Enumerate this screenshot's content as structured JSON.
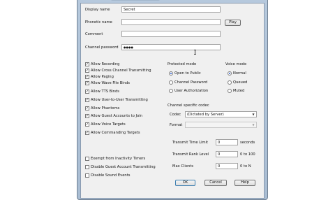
{
  "fields": {
    "display_name_label": "Display name",
    "display_name_value": "Secret",
    "phonetic_label": "Phonetic name",
    "phonetic_value": "",
    "play_label": "Play",
    "comment_label": "Comment",
    "comment_value": "",
    "password_label": "Channel password",
    "password_value": "●●●●"
  },
  "checkboxes": [
    {
      "label": "Allow Recording",
      "checked": true
    },
    {
      "label": "Allow Cross Channel Transmitting",
      "checked": true
    },
    {
      "label": "Allow Paging",
      "checked": true
    },
    {
      "label": "Allow Wave File Binds",
      "checked": true
    },
    {
      "label": "Allow TTS Binds",
      "checked": true
    },
    {
      "label": "Allow User-to-User Transmitting",
      "checked": true
    },
    {
      "label": "Allow Phantoms",
      "checked": true
    },
    {
      "label": "Allow Guest Accounts to Join",
      "checked": true
    },
    {
      "label": "Allow Voice Targets",
      "checked": true
    },
    {
      "label": "Allow Commanding Targets",
      "checked": true
    }
  ],
  "extra_checkboxes": [
    {
      "label": "Exempt from Inactivity Timers",
      "checked": false
    },
    {
      "label": "Disable Guest Account Transmitting",
      "checked": false
    },
    {
      "label": "Disable Sound Events",
      "checked": false
    }
  ],
  "protected_mode": {
    "title": "Protected mode",
    "options": [
      "Open to Public",
      "Channel Password",
      "User Authorization"
    ],
    "selected": "Open to Public"
  },
  "voice_mode": {
    "title": "Voice mode",
    "options": [
      "Normal",
      "Queued",
      "Muted"
    ],
    "selected": "Normal"
  },
  "codec": {
    "section_title": "Channel specific codec",
    "codec_label": "Codec",
    "codec_value": "(Dictated by Server)",
    "format_label": "Format",
    "format_value": ""
  },
  "limits": {
    "transmit_time_label": "Transmit Time Limit",
    "transmit_time_value": "0",
    "transmit_time_unit": "seconds",
    "transmit_rank_label": "Transmit Rank Level",
    "transmit_rank_value": "0",
    "transmit_rank_unit": "0 to 100",
    "max_clients_label": "Max Clients",
    "max_clients_value": "0",
    "max_clients_unit": "0 to N"
  },
  "buttons": {
    "ok": "OK",
    "cancel": "Cancel",
    "help": "Help"
  }
}
